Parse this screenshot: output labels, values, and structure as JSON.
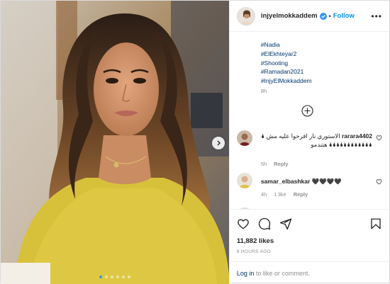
{
  "post": {
    "username": "injyelmokkaddem",
    "follow_label": "Follow",
    "more_label": "•••",
    "separator": "•",
    "caption_tags": [
      "#Nadia",
      "#ElEkhteyar2",
      "#Shooting",
      "#Ramadan2021",
      "#InjyElMokkaddem"
    ],
    "caption_time": "8h",
    "likes": "11,882 likes",
    "post_time": "8 HOURS AGO",
    "login_link": "Log in",
    "login_text": "to like or comment."
  },
  "comments": [
    {
      "username": "rarara4402",
      "text": "الاستوري نار افرحوا عليه مش 🌢🌢🌢🌢🌢🌢🌢🌢🌢🌢🌢🌢🌢 هتندمو",
      "time": "5h",
      "likes": "",
      "reply": "Reply"
    },
    {
      "username": "samar_elbashkar",
      "text": "🖤🖤🖤🖤",
      "time": "4h",
      "likes": "1 like",
      "reply": "Reply"
    }
  ],
  "carousel": {
    "count": 6,
    "active": 0
  },
  "colors": {
    "link": "#00376b",
    "follow": "#0095f6",
    "verified": "#3897f0",
    "sweater": "#d8c13a"
  },
  "icons": [
    "heart-icon",
    "comment-icon",
    "share-icon",
    "bookmark-icon",
    "plus-circle-icon",
    "verified-icon",
    "chevron-right-icon"
  ]
}
